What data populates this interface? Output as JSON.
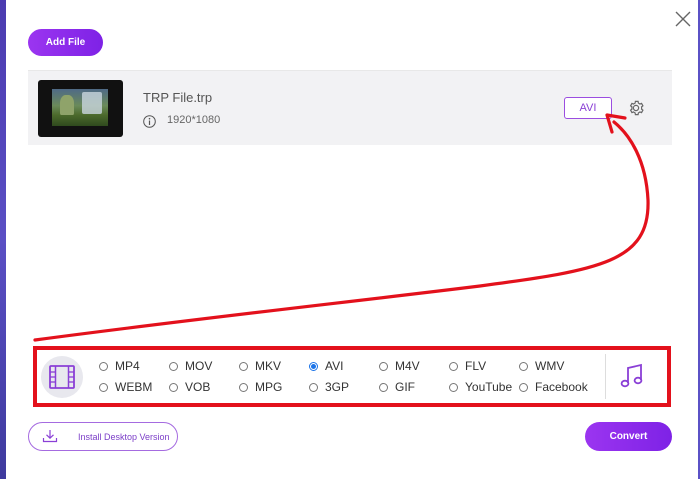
{
  "header": {
    "add_file_label": "Add File",
    "close_icon": "close-icon"
  },
  "file": {
    "name": "TRP File.trp",
    "resolution": "1920*1080",
    "output_format": "AVI",
    "info_icon": "info-icon",
    "settings_icon": "gear-icon"
  },
  "format_panel": {
    "video_tab_icon": "film-icon",
    "audio_tab_icon": "music-note-icon",
    "selected": "AVI",
    "row1": [
      "MP4",
      "MOV",
      "MKV",
      "AVI",
      "M4V",
      "FLV",
      "WMV"
    ],
    "row2": [
      "WEBM",
      "VOB",
      "MPG",
      "3GP",
      "GIF",
      "YouTube",
      "Facebook"
    ]
  },
  "footer": {
    "install_label": "Install Desktop Version",
    "convert_label": "Convert",
    "download_icon": "download-icon"
  },
  "colors": {
    "accent": "#8a2be2",
    "annotation": "#e3111c",
    "radio_selected": "#1a73e8"
  }
}
